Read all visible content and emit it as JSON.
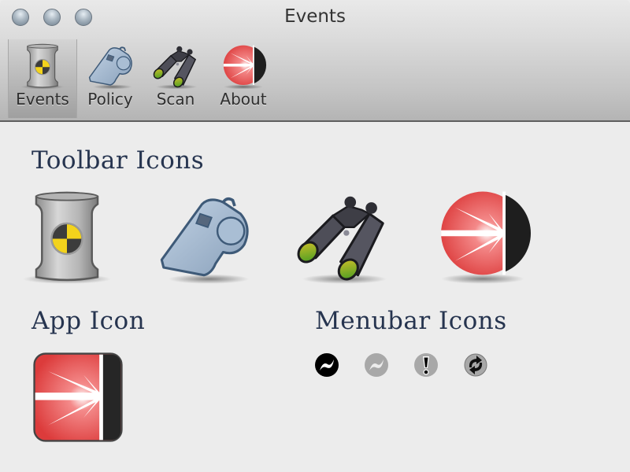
{
  "window": {
    "title": "Events",
    "traffic_lights": [
      "close",
      "minimize",
      "zoom"
    ]
  },
  "toolbar": {
    "items": [
      {
        "label": "Events",
        "icon": "crash-test-barrel-icon",
        "selected": true
      },
      {
        "label": "Policy",
        "icon": "whistle-icon",
        "selected": false
      },
      {
        "label": "Scan",
        "icon": "binoculars-icon",
        "selected": false
      },
      {
        "label": "About",
        "icon": "laser-burst-sphere-icon",
        "selected": false
      }
    ]
  },
  "sections": {
    "toolbar_icons": {
      "title": "Toolbar Icons",
      "icons": [
        "crash-test-barrel-icon",
        "whistle-icon",
        "binoculars-icon",
        "laser-burst-sphere-icon"
      ]
    },
    "app_icon": {
      "title": "App Icon",
      "icon": "laser-burst-app-icon"
    },
    "menubar_icons": {
      "title": "Menubar Icons",
      "icons": [
        "menubar-active-icon",
        "menubar-inactive-icon",
        "menubar-alert-icon",
        "menubar-syncing-icon"
      ]
    }
  },
  "colors": {
    "heading": "#26344f",
    "accent_red": "#e84a4a",
    "barrel_yellow": "#f3d31c",
    "whistle_blue": "#9db3cb"
  }
}
